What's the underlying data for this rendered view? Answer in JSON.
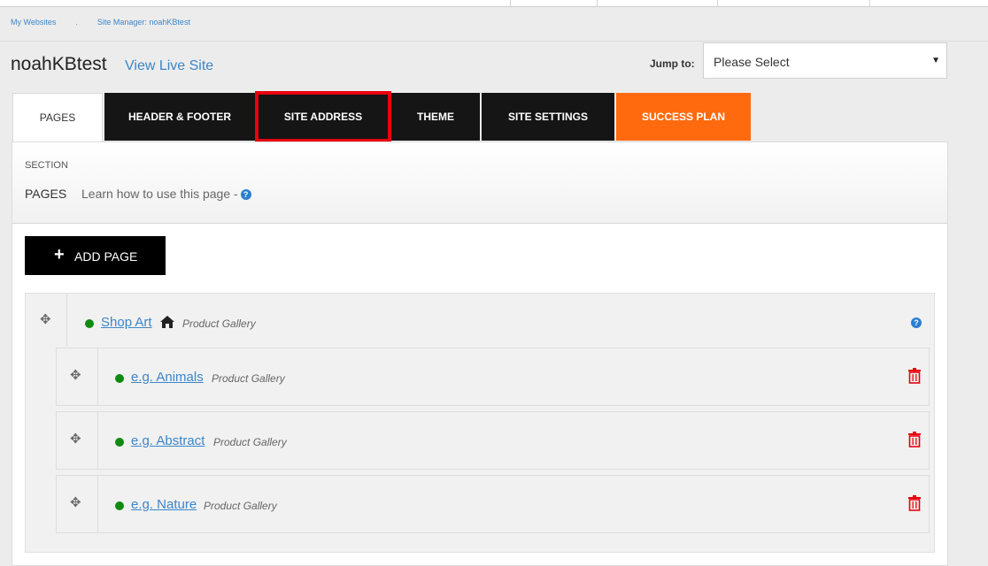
{
  "breadcrumb": {
    "items": [
      "My Websites",
      "Site Manager: noahKBtest"
    ],
    "separator": "."
  },
  "header": {
    "site_name": "noahKBtest",
    "view_live": "View Live Site",
    "jump_label": "Jump to:",
    "jump_value": "Please Select"
  },
  "tabs": [
    {
      "label": "PAGES",
      "active": true
    },
    {
      "label": "HEADER & FOOTER"
    },
    {
      "label": "SITE ADDRESS",
      "highlighted": true
    },
    {
      "label": "THEME"
    },
    {
      "label": "SITE SETTINGS"
    },
    {
      "label": "SUCCESS PLAN",
      "accent": "#ff6a0f"
    }
  ],
  "section": {
    "label": "SECTION",
    "name": "PAGES",
    "learn": "Learn how to use this page -"
  },
  "add_page_label": "ADD PAGE",
  "pages": [
    {
      "name": "Shop Art",
      "type": "Product Gallery",
      "home": true
    },
    {
      "name": "e.g. Animals",
      "type": "Product Gallery"
    },
    {
      "name": "e.g. Abstract",
      "type": "Product Gallery"
    },
    {
      "name": "e.g. Nature",
      "type": "Product Gallery"
    }
  ],
  "colors": {
    "link": "#3b86c9",
    "tab_dark": "#151515",
    "accent": "#ff6a0f",
    "highlight": "#e8000e",
    "status_green": "#118a11",
    "trash_red": "#e8000e"
  },
  "icons": {
    "move": "move-arrows-icon",
    "home": "home-icon",
    "help": "question-circle-icon",
    "trash": "trash-icon",
    "add": "plus-icon",
    "dropdown": "caret-down-icon"
  }
}
